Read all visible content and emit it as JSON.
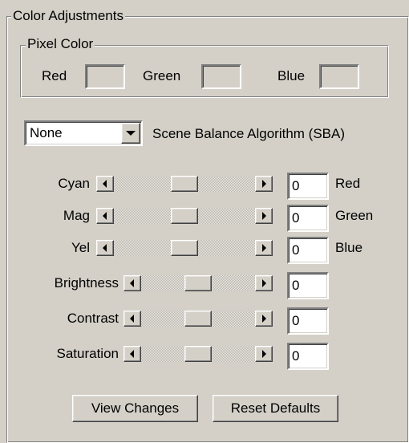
{
  "group_title": "Color Adjustments",
  "pixel_color": {
    "title": "Pixel Color",
    "red_label": "Red",
    "green_label": "Green",
    "blue_label": "Blue",
    "red_value": "",
    "green_value": "",
    "blue_value": ""
  },
  "sba": {
    "selected": "None",
    "label": "Scene Balance Algorithm (SBA)"
  },
  "sliders": [
    {
      "label": "Cyan",
      "value": "0",
      "suffix": "Red",
      "position": 0.5
    },
    {
      "label": "Mag",
      "value": "0",
      "suffix": "Green",
      "position": 0.5
    },
    {
      "label": "Yel",
      "value": "0",
      "suffix": "Blue",
      "position": 0.5
    },
    {
      "label": "Brightness",
      "value": "0",
      "position": 0.5
    },
    {
      "label": "Contrast",
      "value": "0",
      "position": 0.5
    },
    {
      "label": "Saturation",
      "value": "0",
      "position": 0.5
    }
  ],
  "buttons": {
    "view_changes": "View Changes",
    "reset_defaults": "Reset Defaults"
  },
  "colors": {
    "face": "#d4d0c8",
    "highlight": "#ffffff",
    "shadow": "#808080",
    "dark_shadow": "#404040"
  },
  "icons": [
    "scroll-left-icon",
    "scroll-right-icon",
    "dropdown-arrow-icon"
  ]
}
